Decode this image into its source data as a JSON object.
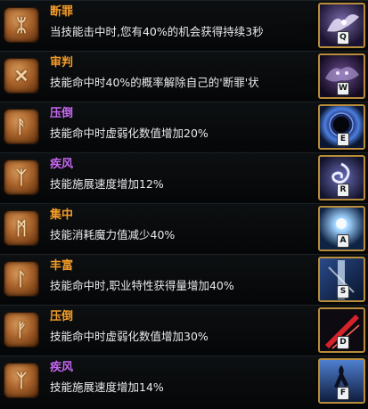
{
  "runes": [
    {
      "title": "断罪",
      "title_color": "#f39b29",
      "description": "当技能击中时,您有40%的机会获得持续3秒",
      "skill_key": "Q",
      "rune_icon": "rune-sigil-icon",
      "skill_icon": "winged-spirit-icon",
      "skill_bg": "#2a1f3c"
    },
    {
      "title": "审判",
      "title_color": "#f39b29",
      "description": "技能命中时40%的概率解除自己的'断罪'状",
      "skill_key": "W",
      "rune_icon": "rune-sigil-icon",
      "skill_icon": "shadow-beast-icon",
      "skill_bg": "#1d1530"
    },
    {
      "title": "压倒",
      "title_color": "#c668f0",
      "description": "技能命中时虚弱化数值增加20%",
      "skill_key": "E",
      "rune_icon": "rune-sigil-icon",
      "skill_icon": "dark-orb-icon",
      "skill_bg": "#0e1d3b"
    },
    {
      "title": "疾风",
      "title_color": "#c668f0",
      "description": "技能施展速度增加12%",
      "skill_key": "R",
      "rune_icon": "rune-sigil-icon",
      "skill_icon": "swirl-icon",
      "skill_bg": "#1b1a3a"
    },
    {
      "title": "集中",
      "title_color": "#f39b29",
      "description": "技能消耗魔力值减少40%",
      "skill_key": "A",
      "rune_icon": "rune-sigil-icon",
      "skill_icon": "spirit-orb-icon",
      "skill_bg": "#16284a"
    },
    {
      "title": "丰富",
      "title_color": "#f39b29",
      "description": "技能命中时,职业特性获得量增加40%",
      "skill_key": "S",
      "rune_icon": "rune-sigil-icon",
      "skill_icon": "light-pillar-icon",
      "skill_bg": "#15274a"
    },
    {
      "title": "压倒",
      "title_color": "#f39b29",
      "description": "技能命中时虚弱化数值增加30%",
      "skill_key": "D",
      "rune_icon": "rune-sigil-icon",
      "skill_icon": "red-slash-icon",
      "skill_bg": "#140c14"
    },
    {
      "title": "疾风",
      "title_color": "#c668f0",
      "description": "技能施展速度增加14%",
      "skill_key": "F",
      "rune_icon": "rune-sigil-icon",
      "skill_icon": "dancer-silhouette-icon",
      "skill_bg": "#1a2d55"
    }
  ]
}
